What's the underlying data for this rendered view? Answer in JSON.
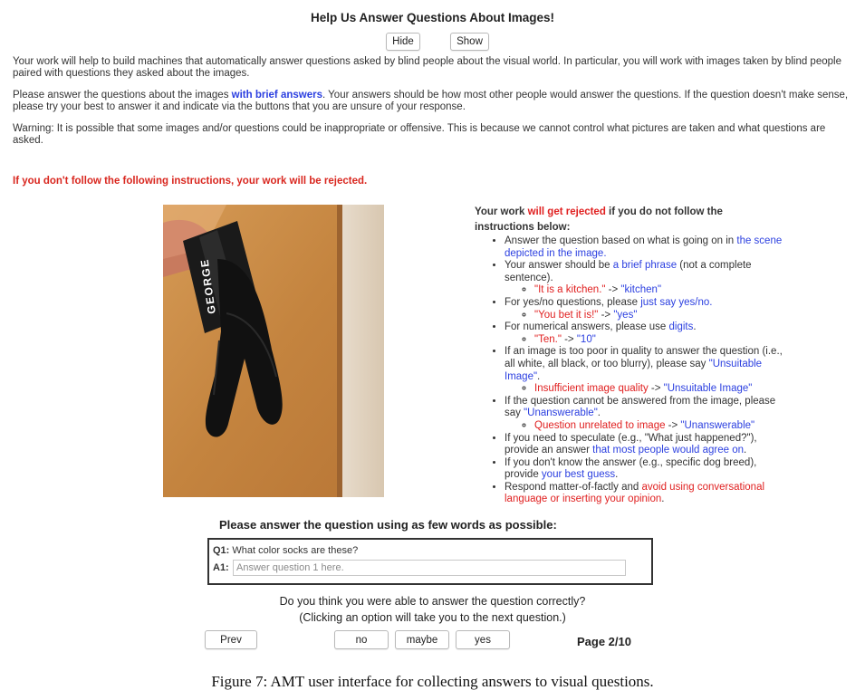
{
  "header": {
    "title": "Help Us Answer Questions About Images!",
    "hide_label": "Hide",
    "show_label": "Show"
  },
  "intro": {
    "p1": "Your work will help to build machines that automatically answer questions asked by blind people about the visual world. In particular, you will work with images taken by blind people paired with questions they asked about the images.",
    "p2_a": "Please answer the questions about the images ",
    "p2_b": "with brief answers",
    "p2_c": ". Your answers should be how most other people would answer the questions. If the question doesn't make sense, please try your best to answer it and indicate via the buttons that you are unsure of your response.",
    "p3": "Warning: It is possible that some images and/or questions could be inappropriate or offensive. This is because we cannot control what pictures are taken and what questions are asked.",
    "reject_warning": "If you don't follow the following instructions, your work will be rejected."
  },
  "photo": {
    "label_text": "GEORGE"
  },
  "instructions": {
    "hdr_a": "Your work ",
    "hdr_b": "will get rejected",
    "hdr_c": " if you do not follow the instructions below:",
    "i1_a": "Answer the question based on what is going on in ",
    "i1_b": "the scene depicted in the image.",
    "i2_a": "Your answer should be ",
    "i2_b": "a brief phrase",
    "i2_c": " (not a complete sentence).",
    "i2_ex_a": "\"It is a kitchen.\"",
    "i2_ex_arrow": " -> ",
    "i2_ex_b": "\"kitchen\"",
    "i3_a": "For yes/no questions, please ",
    "i3_b": "just say yes/no.",
    "i3_ex_a": "\"You bet it is!\"",
    "i3_ex_arrow": " -> ",
    "i3_ex_b": "\"yes\"",
    "i4_a": "For numerical answers, please use ",
    "i4_b": "digits",
    "i4_c": ".",
    "i4_ex_a": "\"Ten.\"",
    "i4_ex_arrow": " -> ",
    "i4_ex_b": "\"10\"",
    "i5_a": "If an image is too poor in quality to answer the question (i.e., all white, all black, or too blurry), please say ",
    "i5_b": "\"Unsuitable Image\"",
    "i5_c": ".",
    "i5_ex_a": "Insufficient image quality",
    "i5_ex_arrow": " -> ",
    "i5_ex_b": "\"Unsuitable Image\"",
    "i6_a": "If the question cannot be answered from the image, please say ",
    "i6_b": "\"Unanswerable\"",
    "i6_c": ".",
    "i6_ex_a": "Question unrelated to image",
    "i6_ex_arrow": " -> ",
    "i6_ex_b": "\"Unanswerable\"",
    "i7_a": "If you need to speculate (e.g., \"What just happened?\"), provide an answer ",
    "i7_b": "that most people would agree on",
    "i7_c": ".",
    "i8_a": "If you don't know the answer (e.g., specific dog breed), provide ",
    "i8_b": "your best guess",
    "i8_c": ".",
    "i9_a": "Respond matter-of-factly and ",
    "i9_b": "avoid using conversational language or inserting your opinion",
    "i9_c": "."
  },
  "question": {
    "header": "Please answer the question using as few words as possible:",
    "q_label": "Q1:",
    "q_text": "What color socks are these?",
    "a_label": "A1:",
    "a_placeholder": "Answer question 1 here.",
    "a_value": ""
  },
  "confidence": {
    "line1": "Do you think you were able to answer the question correctly?",
    "line2": "(Clicking an option will take you to the next question.)",
    "prev_label": "Prev",
    "no_label": "no",
    "maybe_label": "maybe",
    "yes_label": "yes",
    "page_label": "Page 2/10"
  },
  "caption": "Figure 7: AMT user interface for collecting answers to visual questions.",
  "colors": {
    "link_blue": "#2b3fe0",
    "warning_red": "#e02020",
    "photo_background": "#c98a44"
  }
}
